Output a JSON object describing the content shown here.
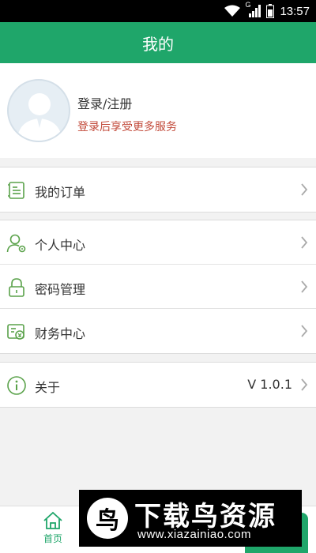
{
  "status_bar": {
    "time": "13:57",
    "network": "G",
    "icons": [
      "wifi-icon",
      "signal-icon",
      "battery-icon"
    ]
  },
  "header": {
    "title": "我的"
  },
  "profile": {
    "login_label": "登录/注册",
    "subtitle": "登录后享受更多服务",
    "subtitle_color": "#c24a3a",
    "avatar_icon": "avatar-placeholder-icon"
  },
  "menu": {
    "orders": {
      "label": "我的订单",
      "icon": "order-list-icon"
    },
    "personal": {
      "label": "个人中心",
      "icon": "user-settings-icon"
    },
    "password": {
      "label": "密码管理",
      "icon": "lock-icon"
    },
    "finance": {
      "label": "财务中心",
      "icon": "finance-icon"
    },
    "about": {
      "label": "关于",
      "icon": "info-icon",
      "version": "V 1.0.1"
    }
  },
  "tabbar": {
    "home_label": "首页",
    "home_icon": "home-icon"
  },
  "watermark": {
    "title": "下载鸟资源",
    "url": "www.xiazainiao.com"
  },
  "colors": {
    "accent": "#1fa66a",
    "background": "#f2f2f2"
  }
}
